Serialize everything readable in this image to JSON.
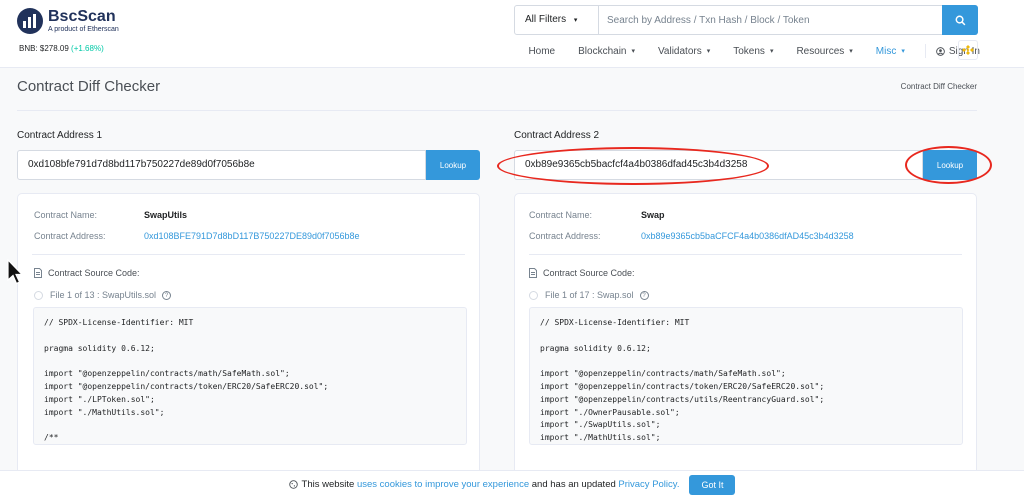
{
  "header": {
    "logo_name": "BscScan",
    "logo_tagline": "A product of Etherscan",
    "bnb_price_label": "BNB: $278.09",
    "bnb_change": "(+1.68%)",
    "search_filter": "All Filters",
    "search_placeholder": "Search by Address / Txn Hash / Block / Token",
    "nav": [
      {
        "label": "Home"
      },
      {
        "label": "Blockchain"
      },
      {
        "label": "Validators"
      },
      {
        "label": "Tokens"
      },
      {
        "label": "Resources"
      },
      {
        "label": "Misc"
      },
      {
        "label": "Sign In"
      }
    ]
  },
  "page": {
    "title": "Contract Diff Checker",
    "breadcrumb": "Contract Diff Checker"
  },
  "left": {
    "label": "Contract Address 1",
    "address": "0xd108bfe791d7d8bd117b750227de89d0f7056b8e",
    "lookup": "Lookup",
    "name_key": "Contract Name:",
    "name_value": "SwapUtils",
    "addr_key": "Contract Address:",
    "addr_value": "0xd108BFE791D7d8bD117B750227DE89d0f7056b8e",
    "source_title": "Contract Source Code:",
    "file_label": "File 1 of 13 : SwapUtils.sol",
    "code": "// SPDX-License-Identifier: MIT\n\npragma solidity 0.6.12;\n\nimport \"@openzeppelin/contracts/math/SafeMath.sol\";\nimport \"@openzeppelin/contracts/token/ERC20/SafeERC20.sol\";\nimport \"./LPToken.sol\";\nimport \"./MathUtils.sol\";\n\n/**\n * @title SwapUtils library"
  },
  "right": {
    "label": "Contract Address 2",
    "address": "0xb89e9365cb5bacfcf4a4b0386dfad45c3b4d3258",
    "lookup": "Lookup",
    "name_key": "Contract Name:",
    "name_value": "Swap",
    "addr_key": "Contract Address:",
    "addr_value": "0xb89e9365cb5baCFCF4a4b0386dfAD45c3b4d3258",
    "source_title": "Contract Source Code:",
    "file_label": "File 1 of 17 : Swap.sol",
    "code": "// SPDX-License-Identifier: MIT\n\npragma solidity 0.6.12;\n\nimport \"@openzeppelin/contracts/math/SafeMath.sol\";\nimport \"@openzeppelin/contracts/token/ERC20/SafeERC20.sol\";\nimport \"@openzeppelin/contracts/utils/ReentrancyGuard.sol\";\nimport \"./OwnerPausable.sol\";\nimport \"./SwapUtils.sol\";\nimport \"./MathUtils.sol\";"
  },
  "cookie": {
    "text1": "This website",
    "link1": "uses cookies to improve your experience",
    "text2": "and has an updated",
    "link2": "Privacy Policy.",
    "button": "Got It"
  },
  "colors": {
    "accent": "#3498db",
    "positive": "#00c9a7",
    "annotation": "#e8281e",
    "brand": "#21325b"
  }
}
